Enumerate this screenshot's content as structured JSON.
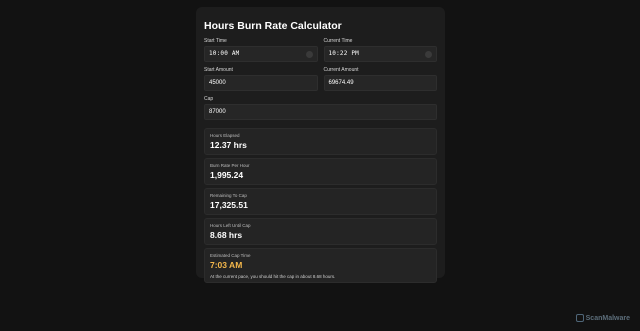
{
  "calculator": {
    "title": "Hours Burn Rate Calculator",
    "start_time_label": "Start Time",
    "start_time_value": "10:00 AM",
    "current_time_label": "Current Time",
    "current_time_value": "10:22 PM",
    "start_amount_label": "Start Amount",
    "start_amount_value": "45000",
    "current_amount_label": "Current Amount",
    "current_amount_value": "69674.49",
    "cap_label": "Cap",
    "cap_value": "87000"
  },
  "results": {
    "hours_elapsed_label": "Hours Elapsed",
    "hours_elapsed_value": "12.37 hrs",
    "burn_rate_label": "Burn Rate Per Hour",
    "burn_rate_value": "1,995.24",
    "remaining_label": "Remaining To Cap",
    "remaining_value": "17,325.51",
    "hours_left_label": "Hours Left Until Cap",
    "hours_left_value": "8.68 hrs",
    "estimated_label": "Estimated Cap Time",
    "estimated_value": "7:03 AM",
    "estimated_note": "At the current pace, you should hit the cap in about 8.68 hours."
  },
  "brand": {
    "text": "ScanMalware",
    "icon": "scanmalware-logo"
  },
  "colors": {
    "accent": "#f5b84b",
    "background": "#121212",
    "card": "#1d1d1d"
  }
}
